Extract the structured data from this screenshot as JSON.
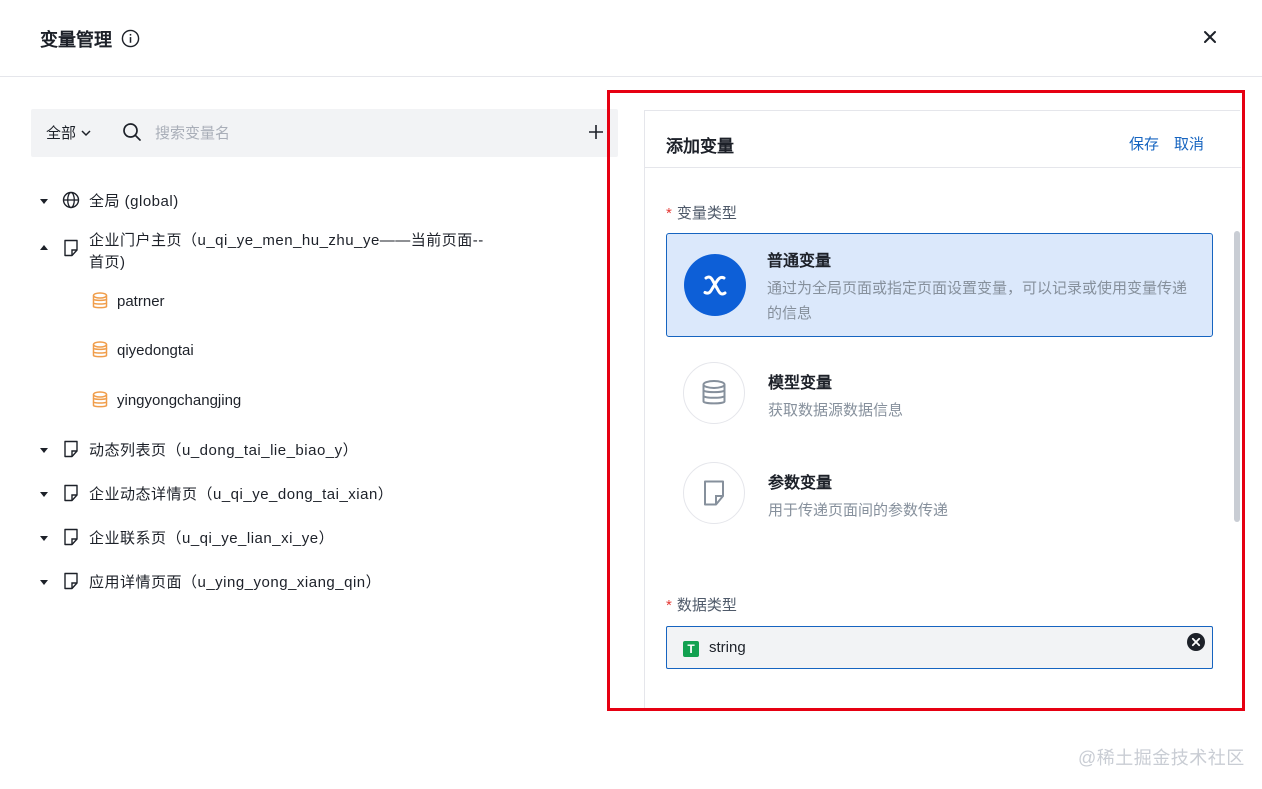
{
  "header": {
    "title": "变量管理"
  },
  "toolbar": {
    "scope_label": "全部",
    "search_placeholder": "搜索变量名"
  },
  "tree": {
    "global": {
      "label": "全局 (global)"
    },
    "home_page": {
      "label_line1": "企业门户主页（u_qi_ye_men_hu_zhu_ye——当前页面--",
      "label_line2": "首页)",
      "children": [
        "patrner",
        "qiyedongtai",
        "yingyongchangjing"
      ]
    },
    "pages": [
      "动态列表页（u_dong_tai_lie_biao_y）",
      "企业动态详情页（u_qi_ye_dong_tai_xian）",
      "企业联系页（u_qi_ye_lian_xi_ye）",
      "应用详情页面（u_ying_yong_xiang_qin）"
    ]
  },
  "panel": {
    "title": "添加变量",
    "save_label": "保存",
    "cancel_label": "取消",
    "variable_type_label": "变量类型",
    "required_mark": "*",
    "types": [
      {
        "name": "普通变量",
        "desc": "通过为全局页面或指定页面设置变量，可以记录或使用变量传递的信息",
        "icon": "variable-x-icon",
        "selected": true
      },
      {
        "name": "模型变量",
        "desc": "获取数据源数据信息",
        "icon": "database-icon",
        "selected": false
      },
      {
        "name": "参数变量",
        "desc": "用于传递页面间的参数传递",
        "icon": "page-icon",
        "selected": false
      }
    ],
    "data_type_label": "数据类型",
    "data_type_badge": "T",
    "data_type_value": "string"
  },
  "watermark": "@稀土掘金技术社区",
  "colors": {
    "accent": "#1664c0",
    "selected_bg": "#dbe8fb",
    "icon_primary": "#0d5fd7",
    "highlight_frame": "#e60012",
    "db_icon": "#f09d4a",
    "string_badge": "#12a150"
  }
}
